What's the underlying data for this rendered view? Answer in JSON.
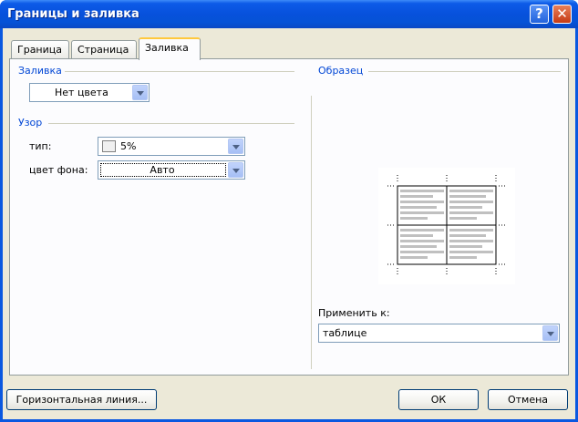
{
  "window": {
    "title": "Границы и заливка",
    "help_label": "?",
    "close_label": "✕"
  },
  "tabs": [
    {
      "label": "Граница"
    },
    {
      "label": "Страница"
    },
    {
      "label": "Заливка"
    }
  ],
  "fill": {
    "group_label": "Заливка",
    "color_value": "Нет цвета"
  },
  "pattern": {
    "group_label": "Узор",
    "type_label": "тип:",
    "type_value": "5%",
    "bg_label": "цвет фона:",
    "bg_value": "Авто"
  },
  "sample": {
    "group_label": "Образец"
  },
  "apply": {
    "label": "Применить к:",
    "value": "таблице"
  },
  "buttons": {
    "horizontal_line": "Горизонтальная линия...",
    "ok": "ОК",
    "cancel": "Отмена"
  },
  "colors": {
    "accent": "#0046d5",
    "titlebar": "#0652d6",
    "face": "#ece9d8"
  }
}
